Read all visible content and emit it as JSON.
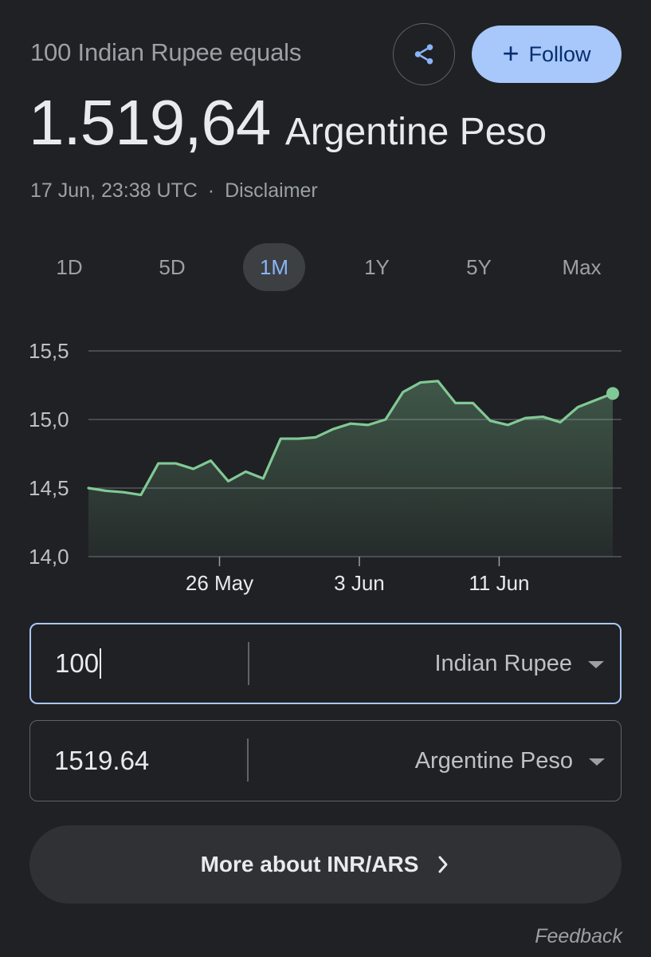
{
  "header": {
    "subtitle": "100 Indian Rupee equals",
    "rate": "1.519,64",
    "currency": "Argentine Peso",
    "timestamp": "17 Jun, 23:38 UTC",
    "separator": "·",
    "disclaimer": "Disclaimer",
    "follow_label": "Follow",
    "follow_icon": "plus-icon",
    "share_icon": "share-icon"
  },
  "tabs": [
    {
      "label": "1D",
      "active": false
    },
    {
      "label": "5D",
      "active": false
    },
    {
      "label": "1M",
      "active": true
    },
    {
      "label": "1Y",
      "active": false
    },
    {
      "label": "5Y",
      "active": false
    },
    {
      "label": "Max",
      "active": false
    }
  ],
  "chart_data": {
    "type": "area",
    "y_ticks": [
      "15,5",
      "15,0",
      "14,5",
      "14,0"
    ],
    "y_tick_values": [
      15.5,
      15.0,
      14.5,
      14.0
    ],
    "ylim": [
      14.0,
      15.5
    ],
    "x_ticks": [
      {
        "label": "26 May",
        "index": 7.5
      },
      {
        "label": "3 Jun",
        "index": 15.5
      },
      {
        "label": "11 Jun",
        "index": 23.5
      }
    ],
    "values": [
      14.5,
      14.48,
      14.47,
      14.45,
      14.68,
      14.68,
      14.64,
      14.7,
      14.55,
      14.62,
      14.57,
      14.86,
      14.86,
      14.87,
      14.93,
      14.97,
      14.96,
      15.0,
      15.2,
      15.27,
      15.28,
      15.12,
      15.12,
      14.99,
      14.96,
      15.01,
      15.02,
      14.98,
      15.09,
      15.14,
      15.19
    ],
    "line_color": "#81c995",
    "fill_color": "#81c995",
    "grid": true
  },
  "converter": {
    "from_value": "100",
    "from_currency": "Indian Rupee",
    "to_value": "1519.64",
    "to_currency": "Argentine Peso",
    "dropdown_icon": "triangle-down-icon"
  },
  "more_button": {
    "label": "More about INR/ARS",
    "icon": "chevron-right-icon"
  },
  "feedback": "Feedback",
  "colors": {
    "background": "#202124",
    "accent": "#a8c7fa",
    "active_tab": "#8ab4f8",
    "chart_line": "#81c995"
  }
}
